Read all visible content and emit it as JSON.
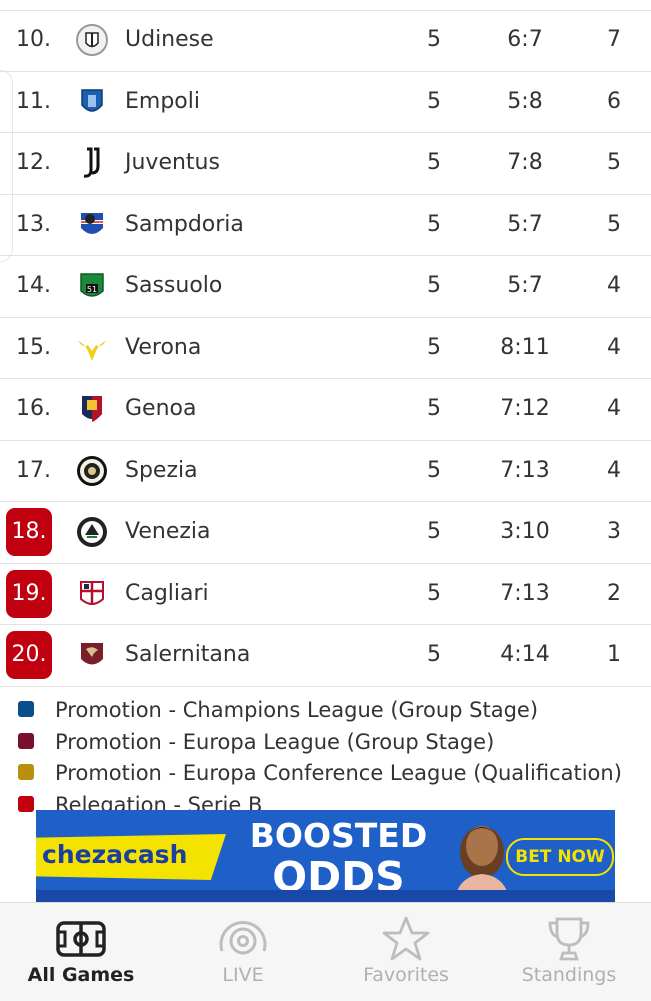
{
  "standings": [
    {
      "rank": "10.",
      "team": "Udinese",
      "played": "5",
      "goals": "6:7",
      "points": "7",
      "relegation": false,
      "logo": "udinese-crest-icon"
    },
    {
      "rank": "11.",
      "team": "Empoli",
      "played": "5",
      "goals": "5:8",
      "points": "6",
      "relegation": false,
      "logo": "empoli-crest-icon"
    },
    {
      "rank": "12.",
      "team": "Juventus",
      "played": "5",
      "goals": "7:8",
      "points": "5",
      "relegation": false,
      "logo": "juventus-crest-icon"
    },
    {
      "rank": "13.",
      "team": "Sampdoria",
      "played": "5",
      "goals": "5:7",
      "points": "5",
      "relegation": false,
      "logo": "sampdoria-crest-icon"
    },
    {
      "rank": "14.",
      "team": "Sassuolo",
      "played": "5",
      "goals": "5:7",
      "points": "4",
      "relegation": false,
      "logo": "sassuolo-crest-icon"
    },
    {
      "rank": "15.",
      "team": "Verona",
      "played": "5",
      "goals": "8:11",
      "points": "4",
      "relegation": false,
      "logo": "verona-crest-icon"
    },
    {
      "rank": "16.",
      "team": "Genoa",
      "played": "5",
      "goals": "7:12",
      "points": "4",
      "relegation": false,
      "logo": "genoa-crest-icon"
    },
    {
      "rank": "17.",
      "team": "Spezia",
      "played": "5",
      "goals": "7:13",
      "points": "4",
      "relegation": false,
      "logo": "spezia-crest-icon"
    },
    {
      "rank": "18.",
      "team": "Venezia",
      "played": "5",
      "goals": "3:10",
      "points": "3",
      "relegation": true,
      "logo": "venezia-crest-icon"
    },
    {
      "rank": "19.",
      "team": "Cagliari",
      "played": "5",
      "goals": "7:13",
      "points": "2",
      "relegation": true,
      "logo": "cagliari-crest-icon"
    },
    {
      "rank": "20.",
      "team": "Salernitana",
      "played": "5",
      "goals": "4:14",
      "points": "1",
      "relegation": true,
      "logo": "salernitana-crest-icon"
    }
  ],
  "legend": [
    {
      "label": "Promotion - Champions League (Group Stage)",
      "color": "#0b4e8c"
    },
    {
      "label": "Promotion - Europa League (Group Stage)",
      "color": "#7a0e2e"
    },
    {
      "label": "Promotion - Europa Conference League (Qualification)",
      "color": "#b8900c"
    },
    {
      "label": "Relegation - Serie B",
      "color": "#c0000f"
    }
  ],
  "ad": {
    "brand": "chezacash",
    "headline_1": "BOOSTED",
    "headline_2": "ODDS",
    "cta": "BET NOW"
  },
  "nav": [
    {
      "label": "All Games",
      "icon": "field-icon",
      "active": true
    },
    {
      "label": "LIVE",
      "icon": "live-broadcast-icon",
      "active": false
    },
    {
      "label": "Favorites",
      "icon": "star-icon",
      "active": false
    },
    {
      "label": "Standings",
      "icon": "trophy-icon",
      "active": false
    }
  ],
  "colors": {
    "relegation": "#c0000f",
    "accent_blue": "#1f5fc8",
    "ad_yellow": "#f4e300"
  }
}
